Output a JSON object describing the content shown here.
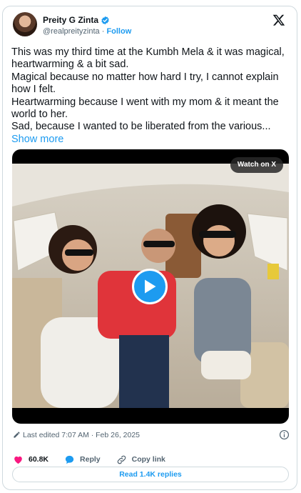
{
  "author": {
    "name": "Preity G Zinta",
    "handle": "@realpreityzinta",
    "separator": " · ",
    "follow_label": "Follow"
  },
  "tweet": {
    "text": "This was my third time at the Kumbh Mela & it was magical, heartwarming & a bit sad.\nMagical because no matter how hard I try, I cannot explain how I felt.\nHeartwarming because I went with my mom & it meant the world to her.\nSad, because I wanted to be liberated from the various... ",
    "show_more": "Show more"
  },
  "media": {
    "watch_label": "Watch on X"
  },
  "meta": {
    "edited": "Last edited 7:07 AM · Feb 26, 2025"
  },
  "actions": {
    "likes": "60.8K",
    "reply_label": "Reply",
    "copy_link_label": "Copy link",
    "read_replies": "Read 1.4K replies"
  },
  "colors": {
    "accent": "#1d9bf0",
    "like": "#f91880",
    "muted": "#536471",
    "border": "#cfd9de"
  },
  "icons": [
    "verified-badge-icon",
    "x-logo-icon",
    "play-icon",
    "pencil-icon",
    "info-icon",
    "heart-icon",
    "reply-bubble-icon",
    "link-icon"
  ]
}
